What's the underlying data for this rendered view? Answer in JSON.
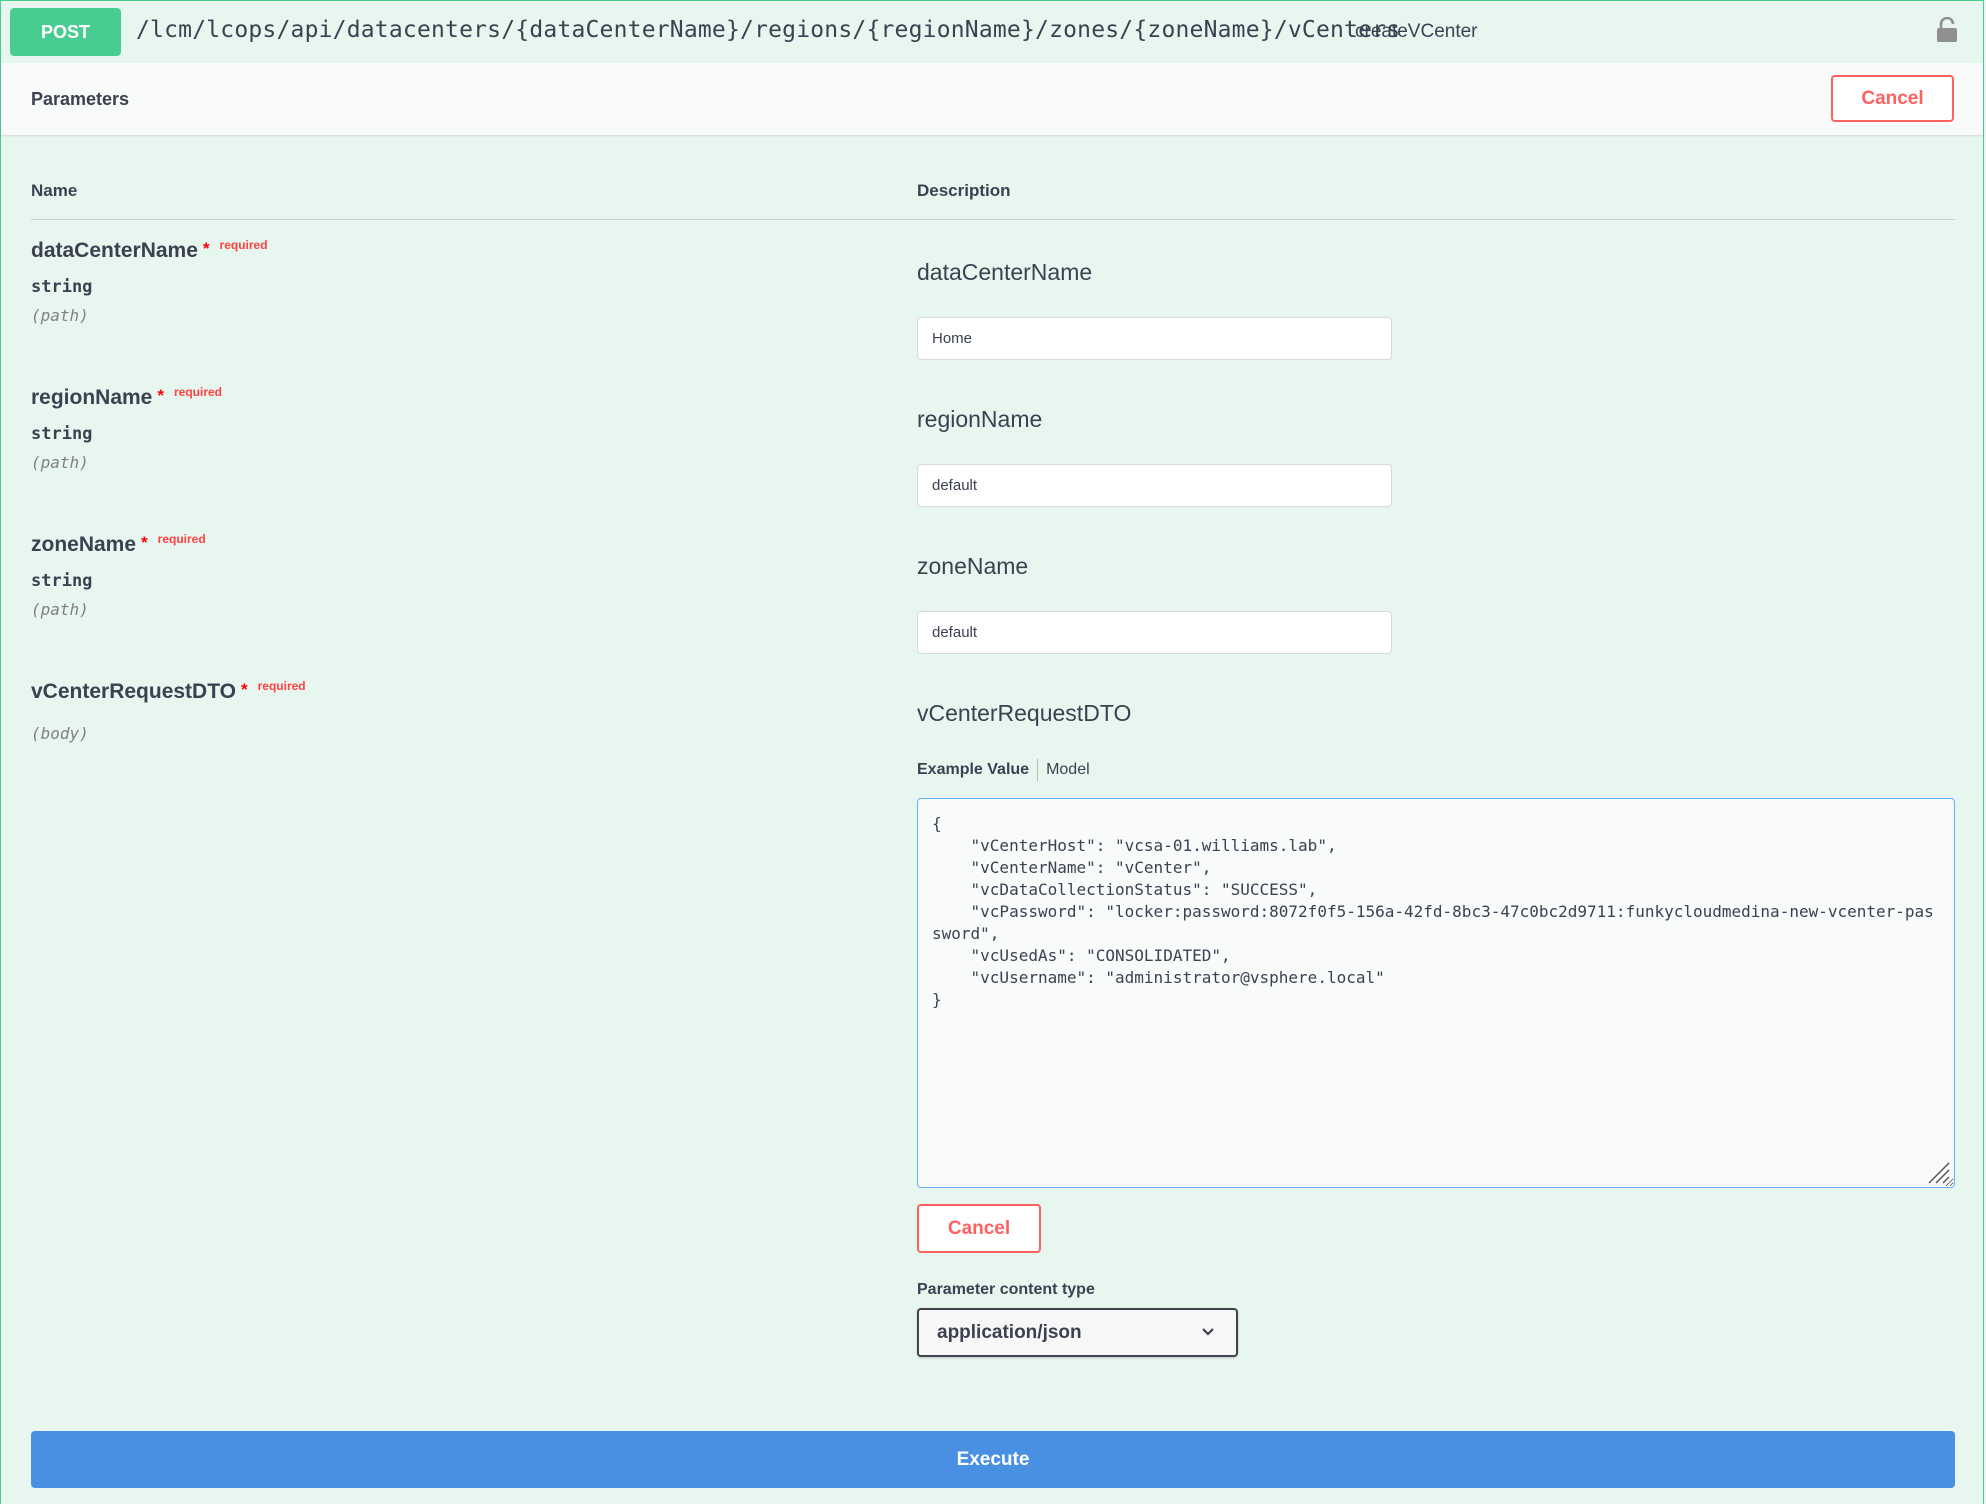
{
  "operation": {
    "method": "POST",
    "path": "/lcm/lcops/api/datacenters/{dataCenterName}/regions/{regionName}/zones/{zoneName}/vCenters",
    "operation_id": "createVCenter",
    "lock_icon": "lock-icon"
  },
  "parameters_header": {
    "title": "Parameters",
    "cancel_label": "Cancel"
  },
  "columns": {
    "name": "Name",
    "description": "Description"
  },
  "params": [
    {
      "name": "dataCenterName",
      "star": "*",
      "required": "required",
      "type": "string",
      "in": "(path)",
      "label": "dataCenterName",
      "value": "Home"
    },
    {
      "name": "regionName",
      "star": "*",
      "required": "required",
      "type": "string",
      "in": "(path)",
      "label": "regionName",
      "value": "default"
    },
    {
      "name": "zoneName",
      "star": "*",
      "required": "required",
      "type": "string",
      "in": "(path)",
      "label": "zoneName",
      "value": "default"
    },
    {
      "name": "vCenterRequestDTO",
      "star": "*",
      "required": "required",
      "in": "(body)",
      "label": "vCenterRequestDTO"
    }
  ],
  "body_editor": {
    "tab_example": "Example Value",
    "tab_model": "Model",
    "json": "{\n    \"vCenterHost\": \"vcsa-01.williams.lab\",\n    \"vCenterName\": \"vCenter\",\n    \"vcDataCollectionStatus\": \"SUCCESS\",\n    \"vcPassword\": \"locker:password:8072f0f5-156a-42fd-8bc3-47c0bc2d9711:funkycloudmedina-new-vcenter-password\",\n    \"vcUsedAs\": \"CONSOLIDATED\",\n    \"vcUsername\": \"administrator@vsphere.local\"\n}",
    "cancel_label": "Cancel"
  },
  "content_type": {
    "label": "Parameter content type",
    "selected": "application/json"
  },
  "execute_label": "Execute",
  "colors": {
    "post_green": "#49cc90",
    "background": "#e8f6f0",
    "cancel_red": "#ff6060",
    "execute_blue": "#4990e2"
  }
}
